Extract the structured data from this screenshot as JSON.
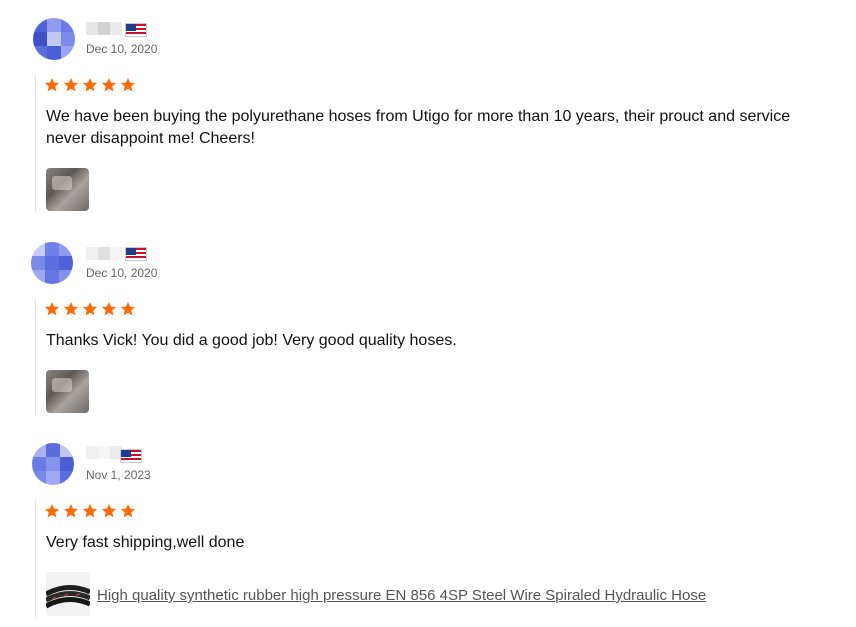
{
  "colors": {
    "star": "#ff6a00",
    "accent_avatar": "#4f63d9"
  },
  "reviews": [
    {
      "date": "Dec 10, 2020",
      "rating": 5,
      "text": "We have been buying the polyurethane hoses from Utigo for more than 10 years, their prouct and service never disappoint me! Cheers!",
      "flag": "us-flag-icon"
    },
    {
      "date": "Dec 10, 2020",
      "rating": 5,
      "text": "Thanks Vick! You did a good job! Very good quality hoses.",
      "flag": "us-flag-icon"
    },
    {
      "date": "Nov 1, 2023",
      "rating": 5,
      "text": "Very fast shipping,well done",
      "flag": "us-flag-icon",
      "product_link": "High quality synthetic rubber high pressure EN 856 4SP Steel Wire Spiraled Hydraulic Hose"
    }
  ]
}
